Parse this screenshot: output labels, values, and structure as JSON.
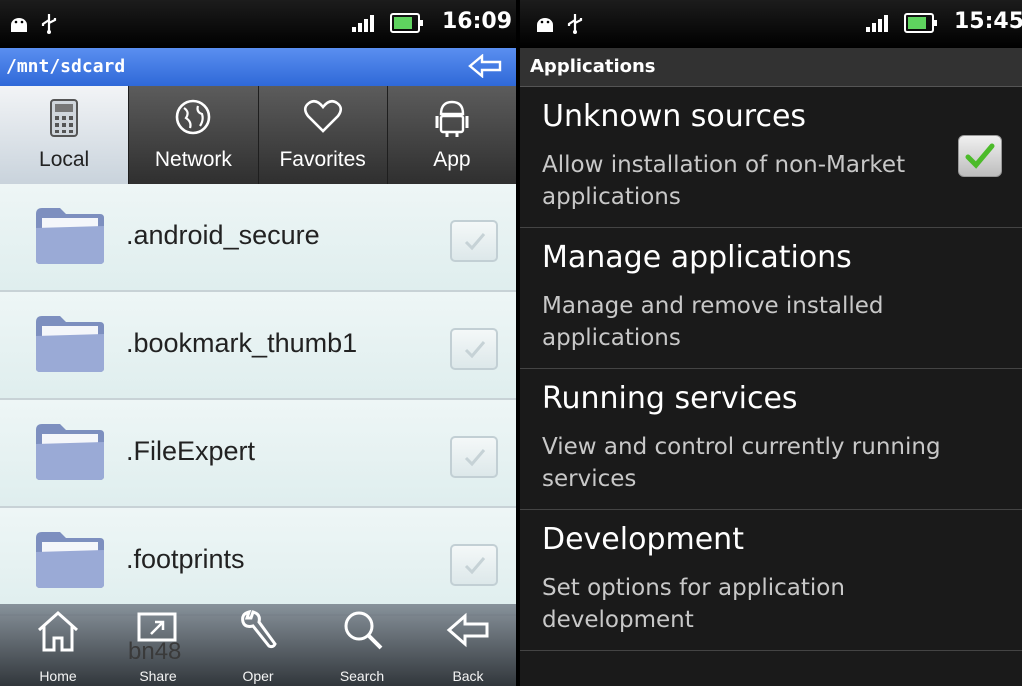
{
  "left": {
    "status": {
      "time": "16:09"
    },
    "path": "/mnt/sdcard",
    "tabs": [
      {
        "label": "Local",
        "icon": "calculator-icon",
        "active": true
      },
      {
        "label": "Network",
        "icon": "globe-icon",
        "active": false
      },
      {
        "label": "Favorites",
        "icon": "heart-icon",
        "active": false
      },
      {
        "label": "App",
        "icon": "android-icon",
        "active": false
      }
    ],
    "files": [
      {
        "name": ".android_secure"
      },
      {
        "name": ".bookmark_thumb1"
      },
      {
        "name": ".FileExpert"
      },
      {
        "name": ".footprints"
      }
    ],
    "partial_file": "bn48",
    "toolbar": [
      {
        "label": "Home",
        "icon": "home-icon"
      },
      {
        "label": "Share",
        "icon": "share-icon"
      },
      {
        "label": "Oper",
        "icon": "wrench-icon"
      },
      {
        "label": "Search",
        "icon": "search-icon"
      },
      {
        "label": "Back",
        "icon": "back-arrow-icon"
      }
    ]
  },
  "right": {
    "status": {
      "time": "15:45"
    },
    "section": "Applications",
    "prefs": [
      {
        "title": "Unknown sources",
        "summary": "Allow installation of non-Market applications",
        "checked": true
      },
      {
        "title": "Manage applications",
        "summary": "Manage and remove installed applications"
      },
      {
        "title": "Running services",
        "summary": "View and control currently running services"
      },
      {
        "title": "Development",
        "summary": "Set options for application development"
      }
    ]
  },
  "colors": {
    "path_bar": "#3c78e0",
    "check_green": "#4cbb2a",
    "settings_bg": "#1a1a1a"
  }
}
